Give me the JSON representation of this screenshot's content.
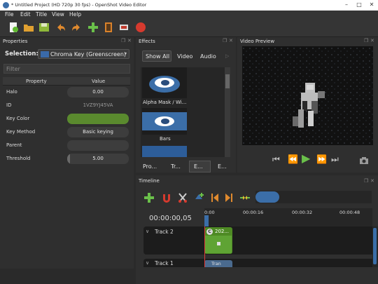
{
  "window": {
    "title": "* Untitled Project (HD 720p 30 fps) - OpenShot Video Editor"
  },
  "menu": [
    "File",
    "Edit",
    "Title",
    "View",
    "Help"
  ],
  "toolbar": {
    "icons": [
      "new-project-icon",
      "open-project-icon",
      "save-project-icon",
      "undo-icon",
      "redo-icon",
      "import-files-icon",
      "profile-icon",
      "fullscreen-icon",
      "export-video-icon"
    ]
  },
  "properties": {
    "title": "Properties",
    "selection_label": "Selection:",
    "selection_value": "Chroma Key (Greenscreen)",
    "filter_placeholder": "Filter",
    "col_property": "Property",
    "col_value": "Value",
    "rows": [
      {
        "name": "Halo",
        "value": "0.00"
      },
      {
        "name": "ID",
        "value": "1VZ9YJ45VA"
      },
      {
        "name": "Key Color",
        "value": ""
      },
      {
        "name": "Key Method",
        "value": "Basic keying"
      },
      {
        "name": "Parent",
        "value": ""
      },
      {
        "name": "Threshold",
        "value": "5.00"
      }
    ],
    "key_color": "#5a8a2e"
  },
  "effects": {
    "title": "Effects",
    "tabs": [
      "Show All",
      "Video",
      "Audio"
    ],
    "items": [
      "Alpha Mask / Wi...",
      "Bars"
    ],
    "bottom_tabs": [
      "Pro...",
      "Tr...",
      "E...",
      "E..."
    ]
  },
  "preview": {
    "title": "Video Preview"
  },
  "timeline": {
    "title": "Timeline",
    "timecode": "00:00:00,05",
    "ticks": [
      "0:00",
      "00:00:16",
      "00:00:32",
      "00:00:48"
    ],
    "tracks": [
      "Track 2",
      "Track 1"
    ],
    "clip_label": "202...",
    "clip_badge": "C",
    "transition_label": "Tran"
  },
  "colors": {
    "accent_green": "#5a8a2e",
    "playhead": "#e23a3a",
    "play_green": "#6ac04a"
  }
}
